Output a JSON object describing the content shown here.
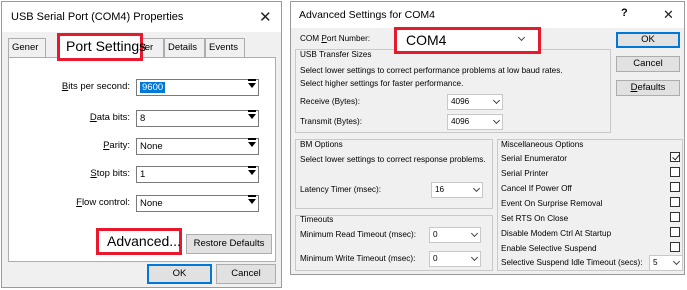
{
  "left_dialog": {
    "title": "USB Serial Port (COM4) Properties",
    "close_glyph": "✕",
    "tabs": [
      "Gener",
      "Port Settings",
      "ver",
      "Details",
      "Events"
    ],
    "fields": [
      {
        "label": "Bits per second:",
        "mnemonic": "B",
        "value": "9600"
      },
      {
        "label": "Data bits:",
        "mnemonic": "D",
        "value": "8"
      },
      {
        "label": "Parity:",
        "mnemonic": "P",
        "value": "None"
      },
      {
        "label": "Stop bits:",
        "mnemonic": "S",
        "value": "1"
      },
      {
        "label": "Flow control:",
        "mnemonic": "F",
        "value": "None"
      }
    ],
    "advanced_button": "Advanced...",
    "restore_button": "Restore Defaults",
    "ok_button": "OK",
    "cancel_button": "Cancel"
  },
  "right_dialog": {
    "title": "Advanced Settings for COM4",
    "help_glyph": "?",
    "close_glyph": "✕",
    "com_port_label": "COM Port Number:",
    "com_port_value": "COM4",
    "usb_group": {
      "title": "USB Transfer Sizes",
      "line1": "Select lower settings to correct performance problems at low baud rates.",
      "line2": "Select higher settings for faster performance.",
      "receive_label": "Receive (Bytes):",
      "receive_value": "4096",
      "transmit_label": "Transmit (Bytes):",
      "transmit_value": "4096"
    },
    "bm_group": {
      "title": "BM Options",
      "line1": "Select lower settings to correct response problems.",
      "latency_label": "Latency Timer (msec):",
      "latency_value": "16"
    },
    "timeouts_group": {
      "title": "Timeouts",
      "read_label": "Minimum Read Timeout (msec):",
      "read_value": "0",
      "write_label": "Minimum Write Timeout (msec):",
      "write_value": "0"
    },
    "misc_group": {
      "title": "Miscellaneous Options",
      "options": [
        {
          "label": "Serial Enumerator",
          "checked": true
        },
        {
          "label": "Serial Printer",
          "checked": false
        },
        {
          "label": "Cancel If Power Off",
          "checked": false
        },
        {
          "label": "Event On Surprise Removal",
          "checked": false
        },
        {
          "label": "Set RTS On Close",
          "checked": false
        },
        {
          "label": "Disable Modem Ctrl At Startup",
          "checked": false
        },
        {
          "label": "Enable Selective Suspend",
          "checked": false
        }
      ],
      "suspend_label": "Selective Suspend Idle Timeout (secs):",
      "suspend_value": "5"
    },
    "ok_button": "OK",
    "cancel_button": "Cancel",
    "defaults_button": "Defaults"
  },
  "colors": {
    "highlight": "#e8182d",
    "selection": "#0078d7"
  }
}
